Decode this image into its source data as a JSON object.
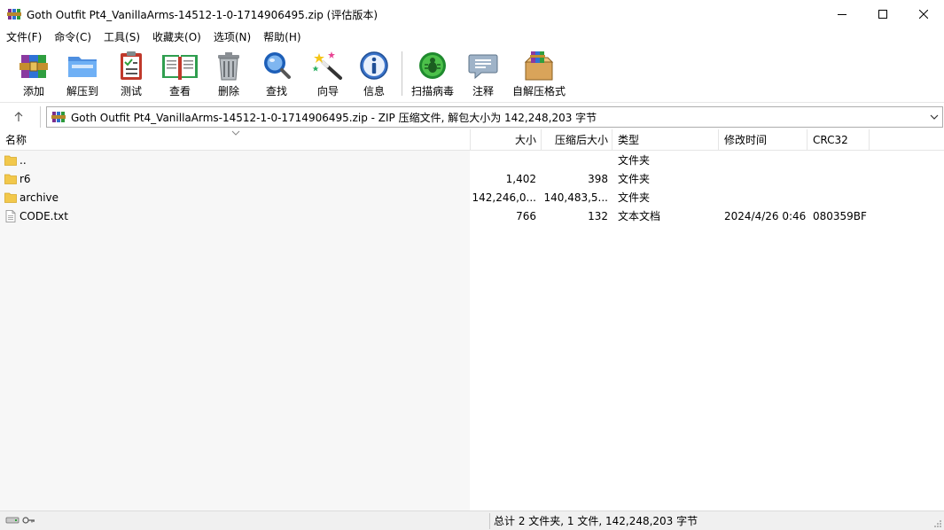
{
  "window": {
    "title": "Goth Outfit Pt4_VanillaArms-14512-1-0-1714906495.zip (评估版本)",
    "controls": [
      "minimize-icon",
      "maximize-icon",
      "close-icon"
    ]
  },
  "menu": [
    "文件(F)",
    "命令(C)",
    "工具(S)",
    "收藏夹(O)",
    "选项(N)",
    "帮助(H)"
  ],
  "toolbar": {
    "add": "添加",
    "extract": "解压到",
    "test": "测试",
    "view": "查看",
    "delete": "删除",
    "find": "查找",
    "wizard": "向导",
    "info": "信息",
    "virus_scan": "扫描病毒",
    "comment": "注释",
    "sfx": "自解压格式"
  },
  "address": {
    "path": "Goth Outfit Pt4_VanillaArms-14512-1-0-1714906495.zip - ZIP 压缩文件, 解包大小为 142,248,203 字节"
  },
  "columns": {
    "name": "名称",
    "size": "大小",
    "packed": "压缩后大小",
    "type": "类型",
    "modified": "修改时间",
    "crc": "CRC32"
  },
  "files": [
    {
      "icon": "folder-up-icon",
      "name": "..",
      "size": "",
      "packed": "",
      "type": "文件夹",
      "modified": "",
      "crc": ""
    },
    {
      "icon": "folder-icon",
      "name": "r6",
      "size": "1,402",
      "packed": "398",
      "type": "文件夹",
      "modified": "",
      "crc": ""
    },
    {
      "icon": "folder-icon",
      "name": "archive",
      "size": "142,246,0...",
      "packed": "140,483,5...",
      "type": "文件夹",
      "modified": "",
      "crc": ""
    },
    {
      "icon": "text-file-icon",
      "name": "CODE.txt",
      "size": "766",
      "packed": "132",
      "type": "文本文档",
      "modified": "2024/4/26 0:46",
      "crc": "080359BF"
    }
  ],
  "status": {
    "summary": "总计 2 文件夹, 1 文件, 142,248,203 字节"
  },
  "colors": {
    "folder": "#f2c84b",
    "name_column_bg": "#f7f7f7",
    "statusbar_bg": "#f0f0f0"
  }
}
